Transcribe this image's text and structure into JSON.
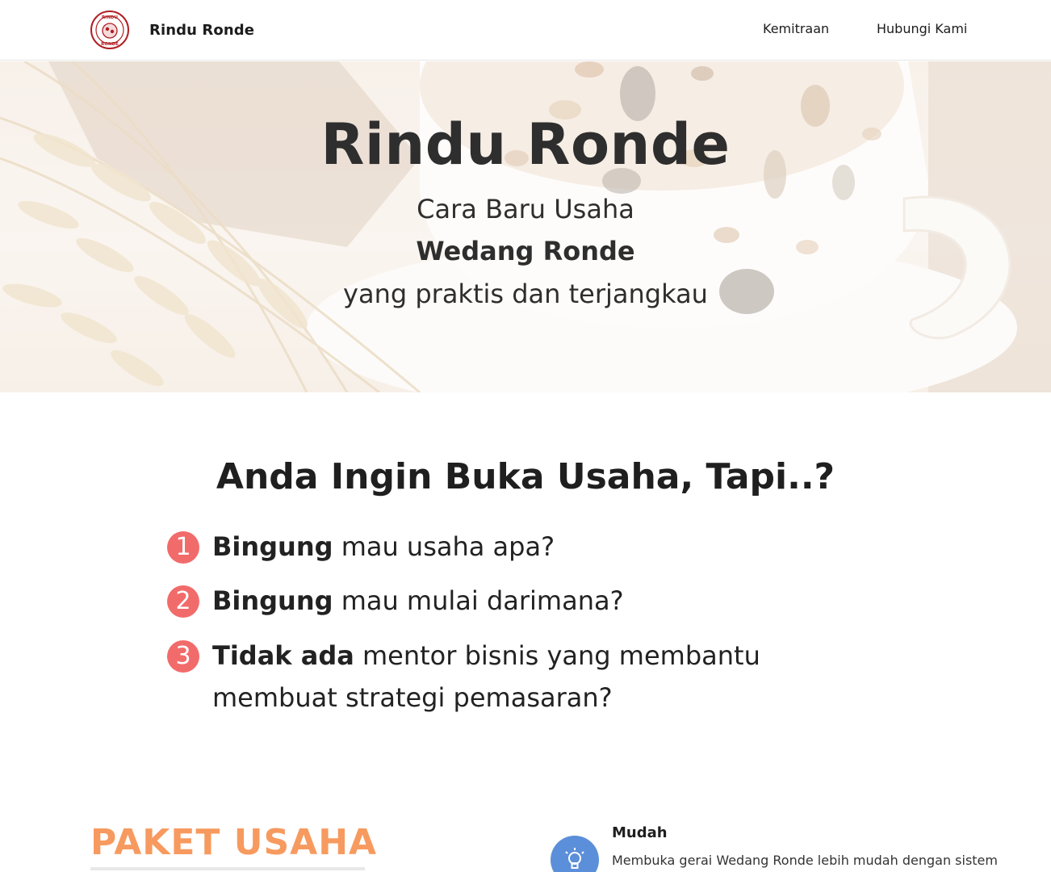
{
  "nav": {
    "brand": "Rindu Ronde",
    "logo_text_top": "RINDU",
    "logo_text_bottom": "RONDE",
    "links": [
      "Kemitraan",
      "Hubungi Kami"
    ]
  },
  "hero": {
    "title": "Rindu Ronde",
    "line1": "Cara Baru Usaha",
    "line2": "Wedang Ronde",
    "line3": "yang praktis dan terjangkau"
  },
  "problems": {
    "title": "Anda Ingin Buka Usaha, Tapi..?",
    "items": [
      {
        "number": "1",
        "bold": "Bingung",
        "rest": " mau usaha apa?"
      },
      {
        "number": "2",
        "bold": "Bingung",
        "rest": " mau mulai darimana?"
      },
      {
        "number": "3",
        "bold": "Tidak ada",
        "rest": " mentor bisnis yang membantu membuat strategi pemasaran?"
      }
    ]
  },
  "paket": {
    "title": "PAKET USAHA"
  },
  "feature": {
    "icon": "lightbulb-icon",
    "title": "Mudah",
    "desc": "Membuka gerai Wedang Ronde lebih mudah dengan sistem"
  },
  "colors": {
    "accent_orange": "#f79a5f",
    "badge_red": "#f26b6b",
    "icon_blue": "#5b8fd9",
    "logo_red": "#b01f24"
  }
}
